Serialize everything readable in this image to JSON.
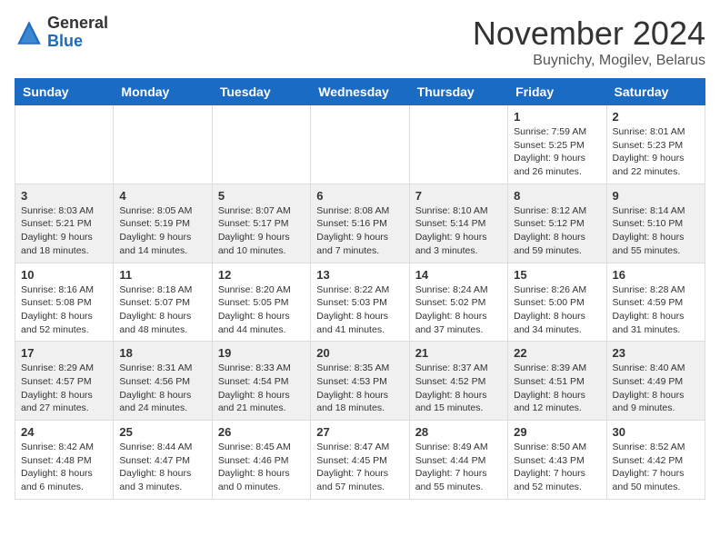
{
  "logo": {
    "general": "General",
    "blue": "Blue"
  },
  "title": "November 2024",
  "location": "Buynichy, Mogilev, Belarus",
  "weekdays": [
    "Sunday",
    "Monday",
    "Tuesday",
    "Wednesday",
    "Thursday",
    "Friday",
    "Saturday"
  ],
  "weeks": [
    [
      {
        "day": "",
        "info": ""
      },
      {
        "day": "",
        "info": ""
      },
      {
        "day": "",
        "info": ""
      },
      {
        "day": "",
        "info": ""
      },
      {
        "day": "",
        "info": ""
      },
      {
        "day": "1",
        "info": "Sunrise: 7:59 AM\nSunset: 5:25 PM\nDaylight: 9 hours\nand 26 minutes."
      },
      {
        "day": "2",
        "info": "Sunrise: 8:01 AM\nSunset: 5:23 PM\nDaylight: 9 hours\nand 22 minutes."
      }
    ],
    [
      {
        "day": "3",
        "info": "Sunrise: 8:03 AM\nSunset: 5:21 PM\nDaylight: 9 hours\nand 18 minutes."
      },
      {
        "day": "4",
        "info": "Sunrise: 8:05 AM\nSunset: 5:19 PM\nDaylight: 9 hours\nand 14 minutes."
      },
      {
        "day": "5",
        "info": "Sunrise: 8:07 AM\nSunset: 5:17 PM\nDaylight: 9 hours\nand 10 minutes."
      },
      {
        "day": "6",
        "info": "Sunrise: 8:08 AM\nSunset: 5:16 PM\nDaylight: 9 hours\nand 7 minutes."
      },
      {
        "day": "7",
        "info": "Sunrise: 8:10 AM\nSunset: 5:14 PM\nDaylight: 9 hours\nand 3 minutes."
      },
      {
        "day": "8",
        "info": "Sunrise: 8:12 AM\nSunset: 5:12 PM\nDaylight: 8 hours\nand 59 minutes."
      },
      {
        "day": "9",
        "info": "Sunrise: 8:14 AM\nSunset: 5:10 PM\nDaylight: 8 hours\nand 55 minutes."
      }
    ],
    [
      {
        "day": "10",
        "info": "Sunrise: 8:16 AM\nSunset: 5:08 PM\nDaylight: 8 hours\nand 52 minutes."
      },
      {
        "day": "11",
        "info": "Sunrise: 8:18 AM\nSunset: 5:07 PM\nDaylight: 8 hours\nand 48 minutes."
      },
      {
        "day": "12",
        "info": "Sunrise: 8:20 AM\nSunset: 5:05 PM\nDaylight: 8 hours\nand 44 minutes."
      },
      {
        "day": "13",
        "info": "Sunrise: 8:22 AM\nSunset: 5:03 PM\nDaylight: 8 hours\nand 41 minutes."
      },
      {
        "day": "14",
        "info": "Sunrise: 8:24 AM\nSunset: 5:02 PM\nDaylight: 8 hours\nand 37 minutes."
      },
      {
        "day": "15",
        "info": "Sunrise: 8:26 AM\nSunset: 5:00 PM\nDaylight: 8 hours\nand 34 minutes."
      },
      {
        "day": "16",
        "info": "Sunrise: 8:28 AM\nSunset: 4:59 PM\nDaylight: 8 hours\nand 31 minutes."
      }
    ],
    [
      {
        "day": "17",
        "info": "Sunrise: 8:29 AM\nSunset: 4:57 PM\nDaylight: 8 hours\nand 27 minutes."
      },
      {
        "day": "18",
        "info": "Sunrise: 8:31 AM\nSunset: 4:56 PM\nDaylight: 8 hours\nand 24 minutes."
      },
      {
        "day": "19",
        "info": "Sunrise: 8:33 AM\nSunset: 4:54 PM\nDaylight: 8 hours\nand 21 minutes."
      },
      {
        "day": "20",
        "info": "Sunrise: 8:35 AM\nSunset: 4:53 PM\nDaylight: 8 hours\nand 18 minutes."
      },
      {
        "day": "21",
        "info": "Sunrise: 8:37 AM\nSunset: 4:52 PM\nDaylight: 8 hours\nand 15 minutes."
      },
      {
        "day": "22",
        "info": "Sunrise: 8:39 AM\nSunset: 4:51 PM\nDaylight: 8 hours\nand 12 minutes."
      },
      {
        "day": "23",
        "info": "Sunrise: 8:40 AM\nSunset: 4:49 PM\nDaylight: 8 hours\nand 9 minutes."
      }
    ],
    [
      {
        "day": "24",
        "info": "Sunrise: 8:42 AM\nSunset: 4:48 PM\nDaylight: 8 hours\nand 6 minutes."
      },
      {
        "day": "25",
        "info": "Sunrise: 8:44 AM\nSunset: 4:47 PM\nDaylight: 8 hours\nand 3 minutes."
      },
      {
        "day": "26",
        "info": "Sunrise: 8:45 AM\nSunset: 4:46 PM\nDaylight: 8 hours\nand 0 minutes."
      },
      {
        "day": "27",
        "info": "Sunrise: 8:47 AM\nSunset: 4:45 PM\nDaylight: 7 hours\nand 57 minutes."
      },
      {
        "day": "28",
        "info": "Sunrise: 8:49 AM\nSunset: 4:44 PM\nDaylight: 7 hours\nand 55 minutes."
      },
      {
        "day": "29",
        "info": "Sunrise: 8:50 AM\nSunset: 4:43 PM\nDaylight: 7 hours\nand 52 minutes."
      },
      {
        "day": "30",
        "info": "Sunrise: 8:52 AM\nSunset: 4:42 PM\nDaylight: 7 hours\nand 50 minutes."
      }
    ]
  ]
}
